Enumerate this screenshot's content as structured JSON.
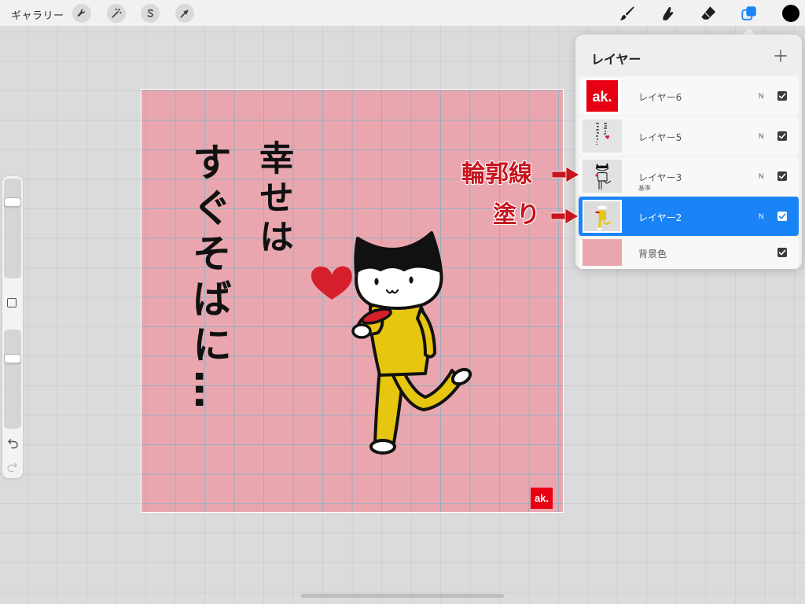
{
  "toolbar": {
    "gallery_label": "ギャラリー",
    "actions": [
      {
        "icon": "wrench-icon"
      },
      {
        "icon": "magic-wand-icon"
      },
      {
        "icon": "selection-icon"
      },
      {
        "icon": "transform-icon"
      }
    ],
    "tools": [
      {
        "icon": "brush-icon",
        "active": false
      },
      {
        "icon": "smudge-icon",
        "active": false
      },
      {
        "icon": "eraser-icon",
        "active": false
      },
      {
        "icon": "layers-icon",
        "active": true
      }
    ],
    "current_color": "#000000"
  },
  "sidebar": {
    "brush_size_level": 0.76,
    "opacity_level": 0.71,
    "icons": [
      "undo-icon",
      "redo-icon"
    ]
  },
  "canvas": {
    "background_color": "#eaa6ae",
    "grid_visible": true,
    "text_right_column": "幸せは",
    "text_left_column": "すぐそばに…",
    "logo_text": "ak."
  },
  "layers_panel": {
    "title": "レイヤー",
    "add_icon": "plus-icon",
    "layers": [
      {
        "name": "レイヤー6",
        "blend_mode": "N",
        "visible": true,
        "selected": false
      },
      {
        "name": "レイヤー5",
        "blend_mode": "N",
        "visible": true,
        "selected": false
      },
      {
        "name": "レイヤー3",
        "sub_label": "基準",
        "blend_mode": "N",
        "visible": true,
        "selected": false
      },
      {
        "name": "レイヤー2",
        "blend_mode": "N",
        "visible": true,
        "selected": true
      }
    ],
    "background_layer": {
      "name": "背景色",
      "color": "#eaa6ae",
      "visible": true
    }
  },
  "annotations": [
    {
      "text": "輪郭線"
    },
    {
      "text": "塗り"
    }
  ],
  "colors": {
    "accent": "#1a84f7",
    "annotation": "#c8141e",
    "cat_body": "#e6c60f",
    "heart": "#d61f2c",
    "logo": "#e60012"
  }
}
